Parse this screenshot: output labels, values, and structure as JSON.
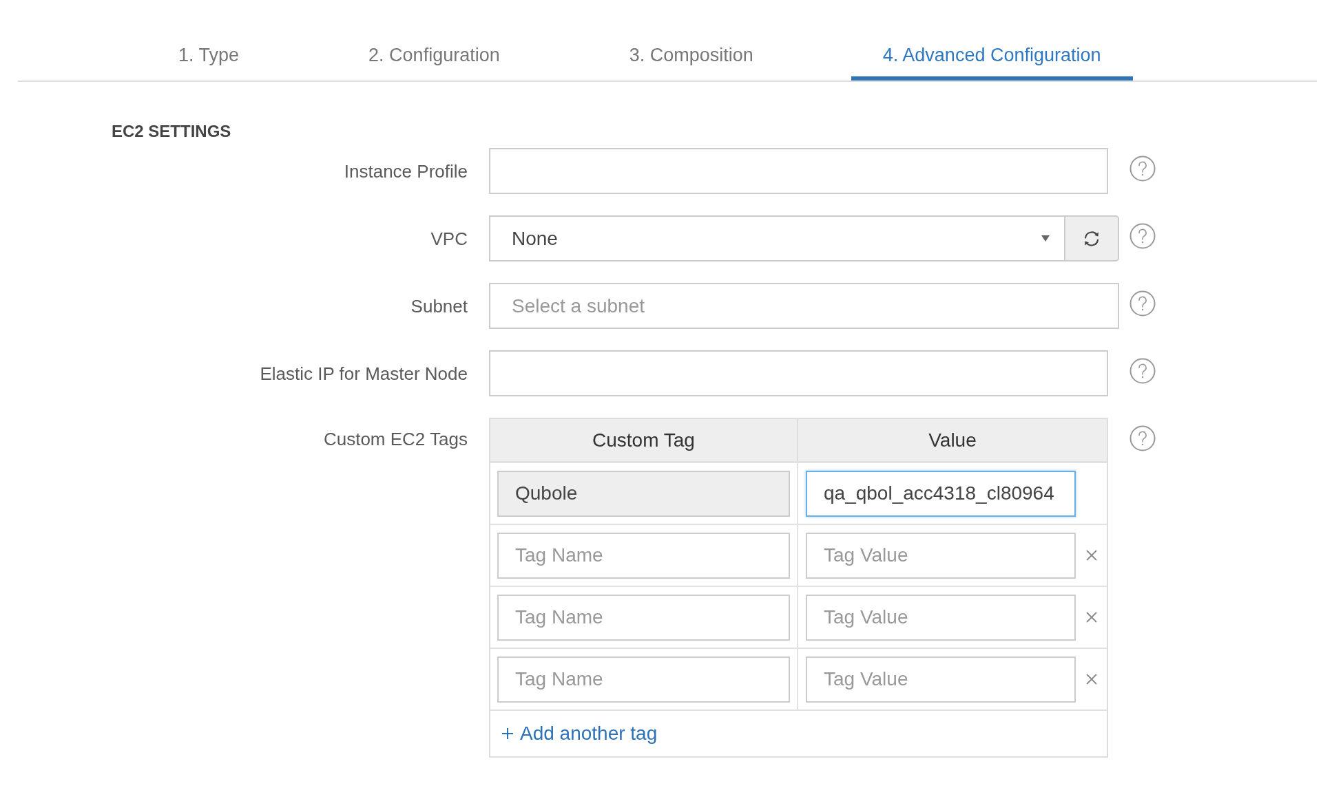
{
  "tabs": [
    {
      "label": "1. Type",
      "selected": false
    },
    {
      "label": "2. Configuration",
      "selected": false
    },
    {
      "label": "3. Composition",
      "selected": false
    },
    {
      "label": "4. Advanced Configuration",
      "selected": true
    }
  ],
  "section": {
    "title": "EC2 SETTINGS",
    "fields": [
      {
        "kind": "text",
        "label": "Instance Profile"
      },
      {
        "kind": "select",
        "label": "VPC",
        "value": "None"
      },
      {
        "kind": "lookup",
        "label": "Subnet",
        "placeholder": "Select a subnet"
      },
      {
        "kind": "text",
        "label": "Elastic IP for Master Node"
      },
      {
        "kind": "tags",
        "label": "Custom EC2 Tags",
        "columns": [
          "Custom Tag",
          "Value"
        ],
        "rows": [
          {
            "name": {
              "value": "Qubole",
              "disabled": true
            },
            "value": {
              "value": "qa_qbol_acc4318_cl80964",
              "focused": true
            },
            "removable": false
          },
          {
            "name": {
              "placeholder": "Tag Name",
              "disabled": false
            },
            "value": {
              "placeholder": "Tag Value",
              "focused": false
            },
            "removable": true
          },
          {
            "name": {
              "placeholder": "Tag Name",
              "disabled": false
            },
            "value": {
              "placeholder": "Tag Value",
              "focused": false
            },
            "removable": true
          },
          {
            "name": {
              "placeholder": "Tag Name",
              "disabled": false
            },
            "value": {
              "placeholder": "Tag Value",
              "focused": false
            },
            "removable": true
          }
        ],
        "add_link": "Add another tag"
      }
    ]
  }
}
